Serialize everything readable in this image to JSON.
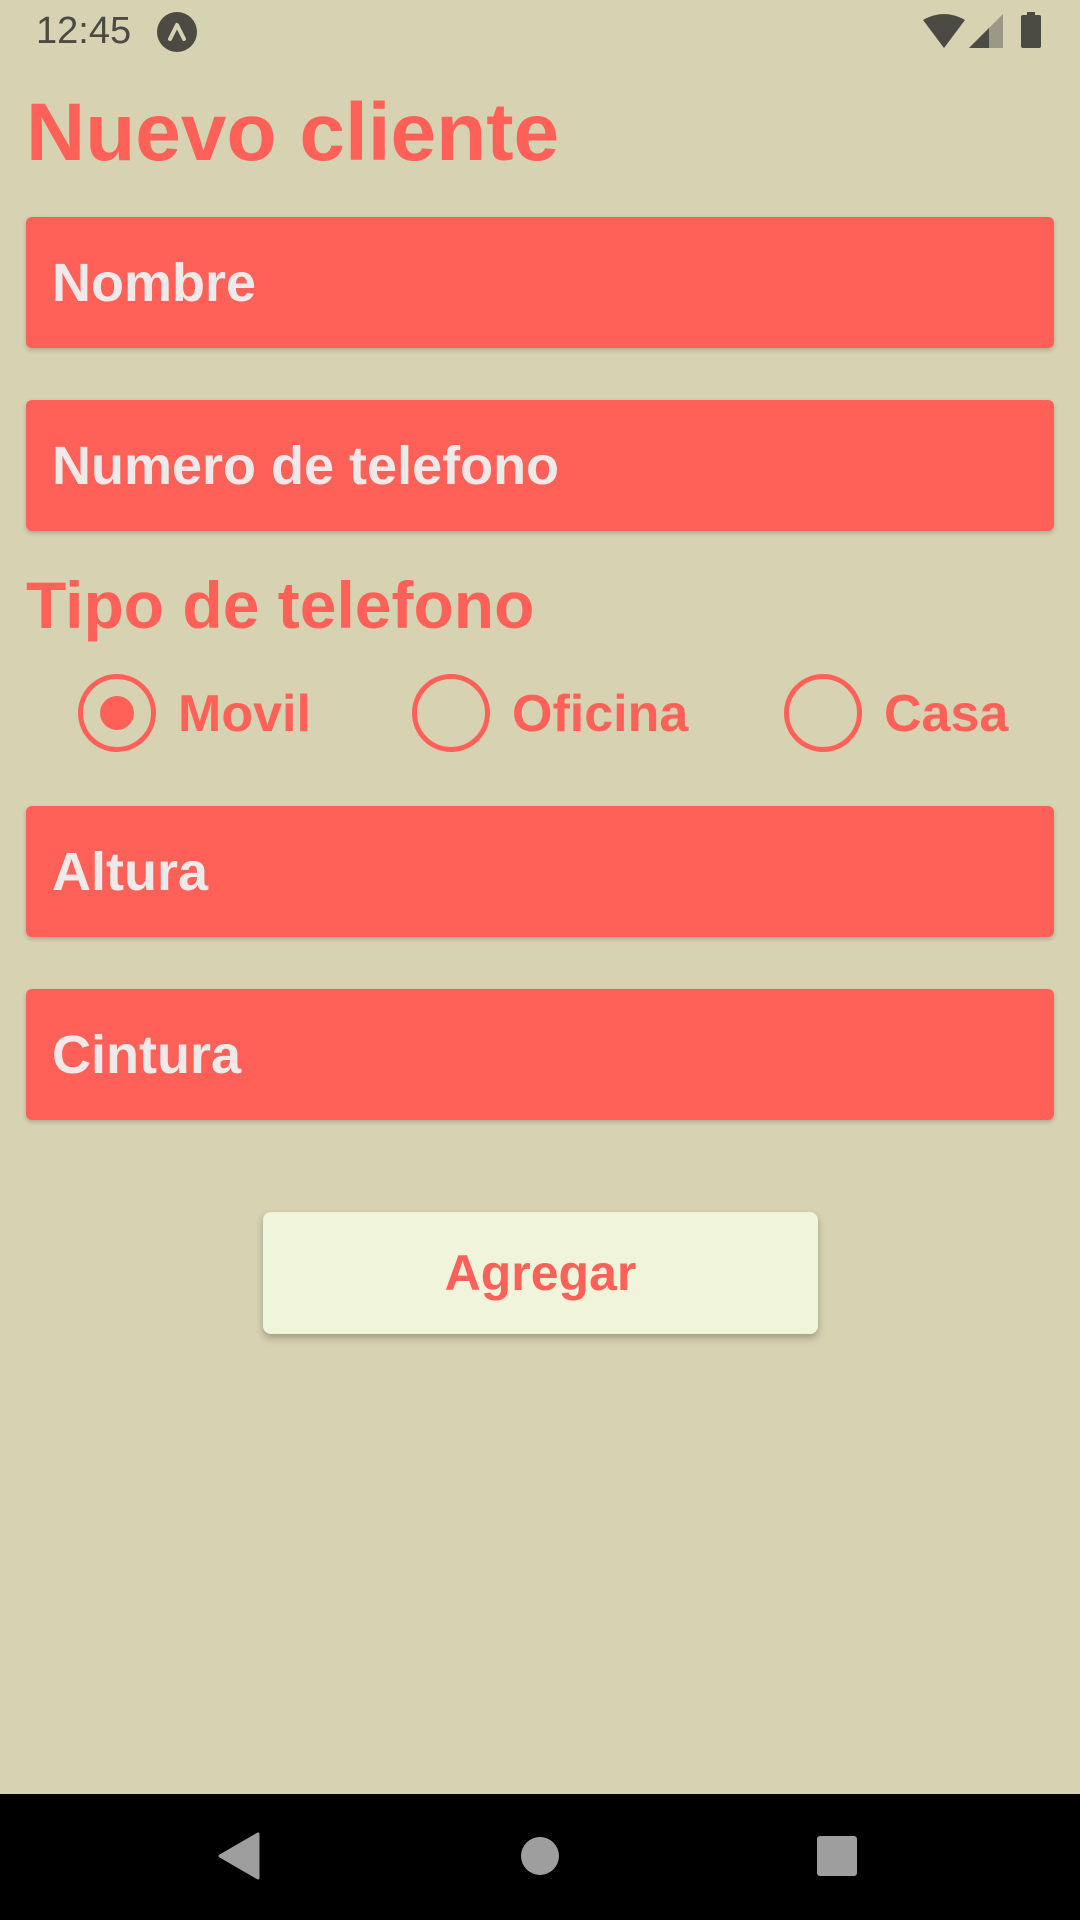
{
  "status_bar": {
    "time": "12:45",
    "icons": [
      "app-notification-icon",
      "wifi-icon",
      "cell-signal-icon",
      "battery-icon"
    ]
  },
  "form": {
    "title": "Nuevo cliente",
    "fields": {
      "nombre": {
        "placeholder": "Nombre",
        "value": ""
      },
      "telefono": {
        "placeholder": "Numero de telefono",
        "value": ""
      },
      "altura": {
        "placeholder": "Altura",
        "value": ""
      },
      "cintura": {
        "placeholder": "Cintura",
        "value": ""
      }
    },
    "phone_type": {
      "label": "Tipo de telefono",
      "options": [
        {
          "label": "Movil",
          "selected": true
        },
        {
          "label": "Oficina",
          "selected": false
        },
        {
          "label": "Casa",
          "selected": false
        }
      ]
    },
    "submit_label": "Agregar"
  },
  "nav_bar": {
    "buttons": [
      "back-icon",
      "home-icon",
      "recents-icon"
    ]
  },
  "colors": {
    "background": "#D6D2B2",
    "accent": "#FF6158",
    "field_text": "#EFE9EA",
    "button_bg": "#EFF4DB",
    "status_icons": "#4B4B43"
  }
}
